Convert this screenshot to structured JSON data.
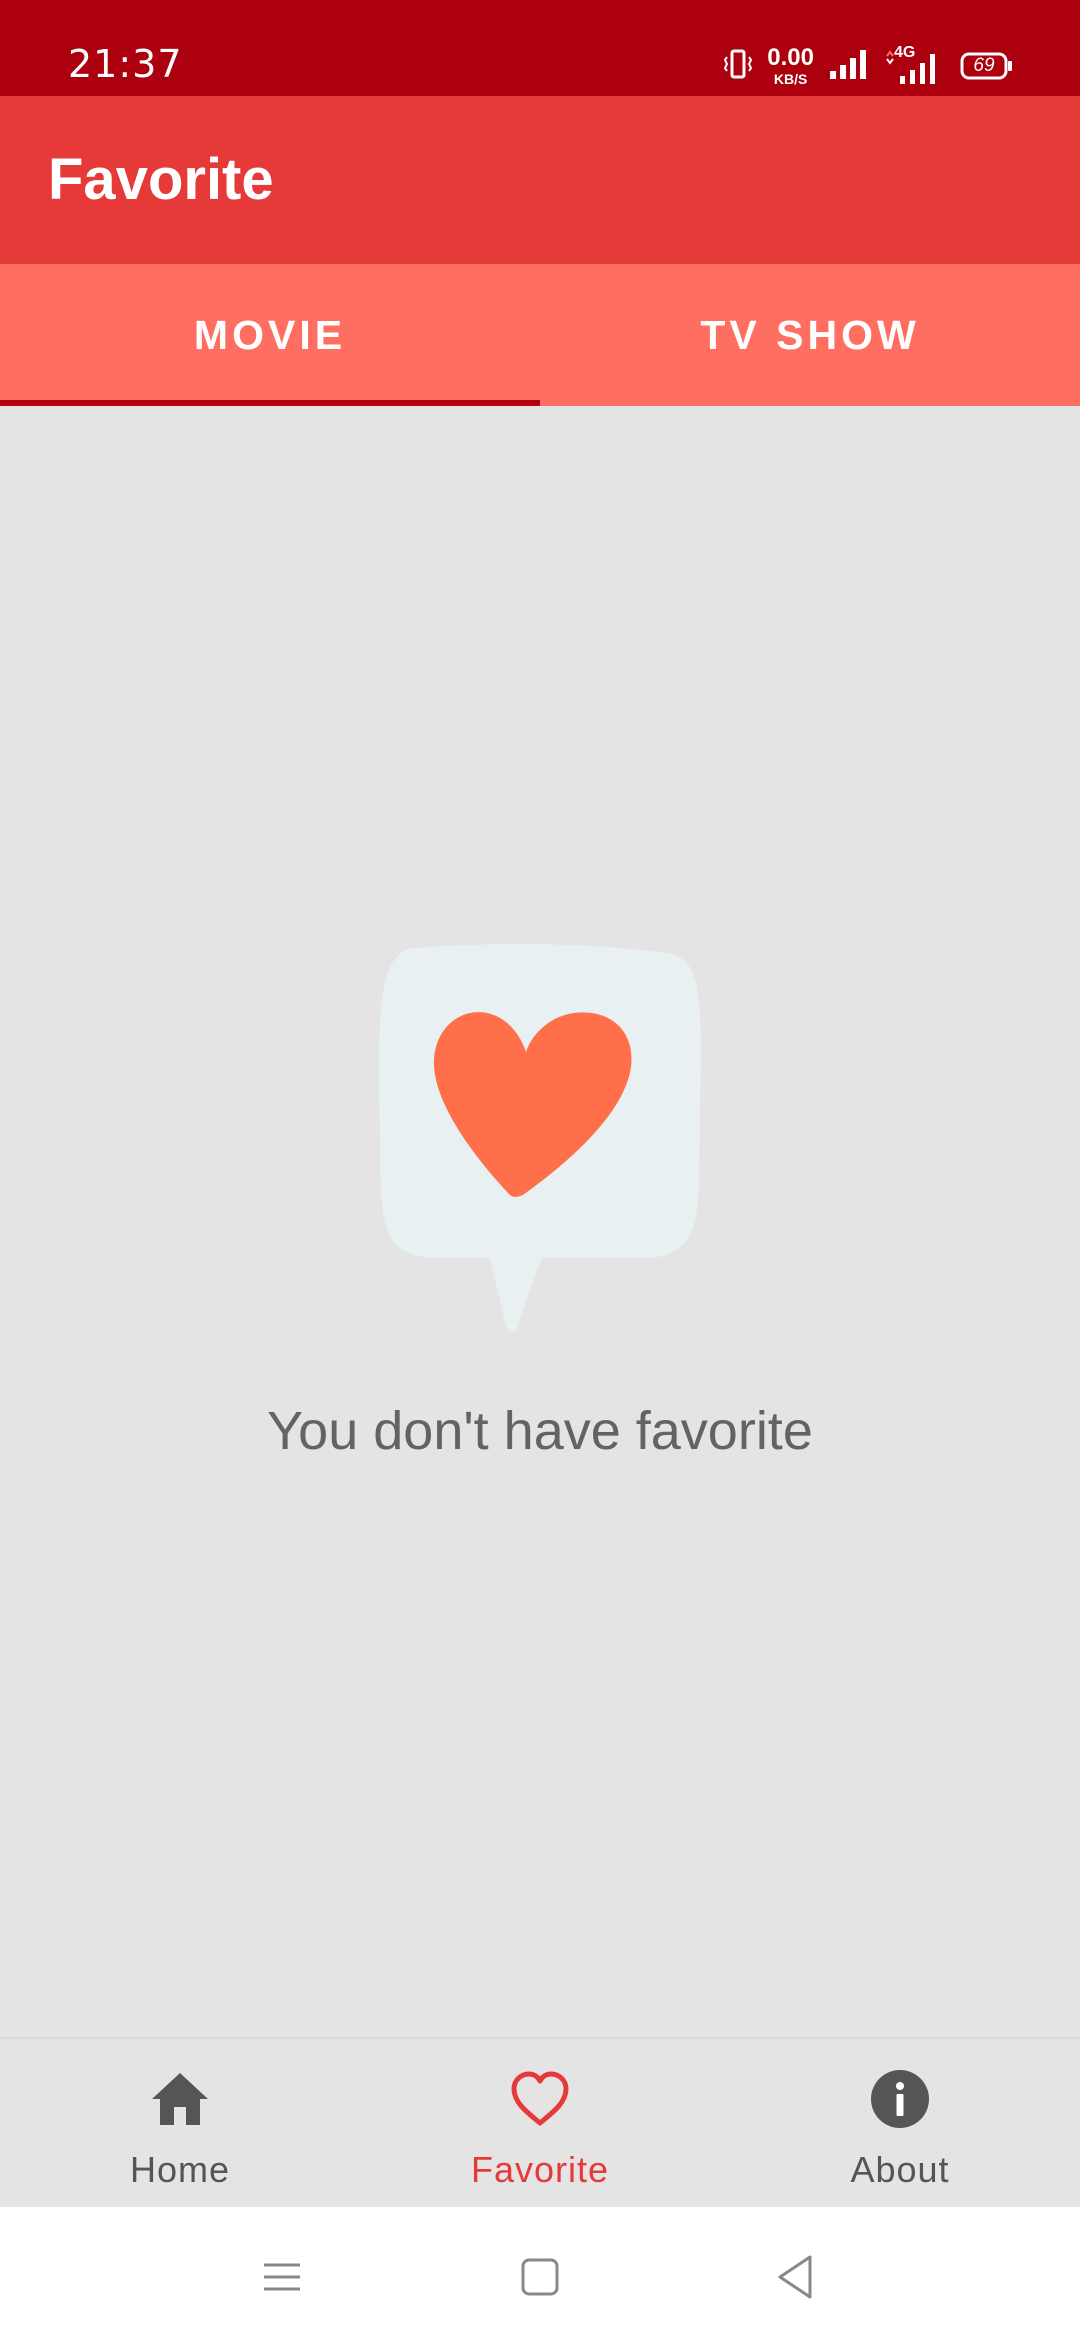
{
  "status_bar": {
    "time": "21:37",
    "speed_value": "0.00",
    "speed_unit": "KB/S",
    "network_type": "4G",
    "battery": "69"
  },
  "app_bar": {
    "title": "Favorite"
  },
  "tabs": [
    {
      "label": "MOVIE",
      "selected": true
    },
    {
      "label": "TV SHOW",
      "selected": false
    }
  ],
  "empty_state": {
    "message": "You don't have favorite",
    "icon": "heart-speech-bubble-icon"
  },
  "bottom_nav": {
    "items": [
      {
        "label": "Home",
        "icon": "home-icon",
        "active": false
      },
      {
        "label": "Favorite",
        "icon": "heart-outline-icon",
        "active": true
      },
      {
        "label": "About",
        "icon": "info-icon",
        "active": false
      }
    ]
  },
  "colors": {
    "status_bar": "#ad000e",
    "app_bar": "#e63a38",
    "tab_bar": "#ff6f61",
    "tab_indicator": "#b2000f",
    "heart": "#ff6f4a",
    "bubble": "#e8f0f1",
    "nav_active": "#e63a38",
    "nav_inactive": "#555555"
  }
}
